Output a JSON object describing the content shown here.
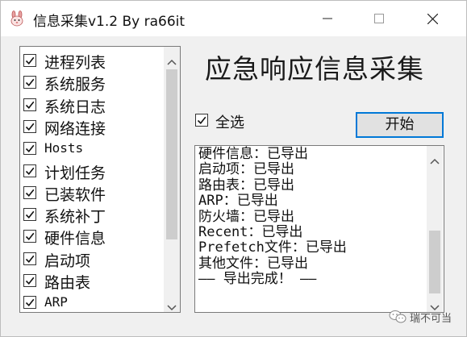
{
  "window": {
    "title": "信息采集v1.2 By ra66it"
  },
  "checklist": {
    "items": [
      {
        "label": "进程列表",
        "checked": true
      },
      {
        "label": "系统服务",
        "checked": true
      },
      {
        "label": "系统日志",
        "checked": true
      },
      {
        "label": "网络连接",
        "checked": true
      },
      {
        "label": "Hosts",
        "checked": true
      },
      {
        "label": "计划任务",
        "checked": true
      },
      {
        "label": "已装软件",
        "checked": true
      },
      {
        "label": "系统补丁",
        "checked": true
      },
      {
        "label": "硬件信息",
        "checked": true
      },
      {
        "label": "启动项",
        "checked": true
      },
      {
        "label": "路由表",
        "checked": true
      },
      {
        "label": "ARP",
        "checked": true
      }
    ]
  },
  "main": {
    "heading": "应急响应信息采集",
    "select_all_label": "全选",
    "select_all_checked": true,
    "start_button_label": "开始"
  },
  "log": {
    "lines": [
      "硬件信息：已导出",
      "启动项：已导出",
      "路由表：已导出",
      "ARP：已导出",
      "防火墙：已导出",
      "Recent：已导出",
      "Prefetch文件：已导出",
      "其他文件：已导出",
      "—— 导出完成！ ——"
    ]
  },
  "watermark": {
    "text": "瑞不可当"
  },
  "colors": {
    "accent": "#0078d7",
    "window_bg": "#f0f0f0",
    "scroll_thumb": "#cdcdcd"
  }
}
